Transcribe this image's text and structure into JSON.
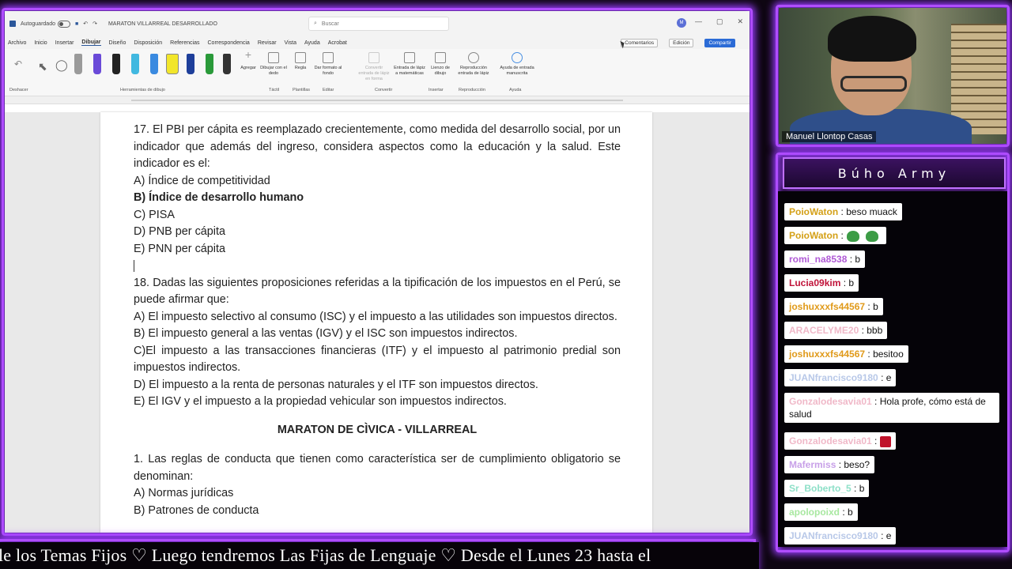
{
  "word": {
    "autosave_label": "Autoguardado",
    "doc_title": "MARATON VILLARREAL DESARROLLADO",
    "search_placeholder": "Buscar",
    "user_initials": "M",
    "menu": [
      "Archivo",
      "Inicio",
      "Insertar",
      "Dibujar",
      "Diseño",
      "Disposición",
      "Referencias",
      "Correspondencia",
      "Revisar",
      "Vista",
      "Ayuda",
      "Acrobat"
    ],
    "active_menu": "Dibujar",
    "comments_label": "Comentarios",
    "edit_label": "Edición",
    "share_label": "Compartir",
    "ribbon": {
      "undo_label": "Deshacer",
      "drawing_tools_label": "Herramientas de dibujo",
      "add_label": "Agregar",
      "draw_finger_label": "Dibujar con el dedo",
      "ruler_label": "Regla",
      "format_bg_label": "Dar formato al fondo",
      "convert_shape_label": "Convertir entrada de lápiz en forma",
      "ink_math_label": "Entrada de lápiz a matemáticas",
      "canvas_label": "Lienzo de dibujo",
      "replay_label": "Reproducción entrada de lápiz",
      "help_ink_label": "Ayuda de entrada manuscrita",
      "groups": [
        "Táctil",
        "Plantillas",
        "Editar",
        "Convertir",
        "Insertar",
        "Reproducción",
        "Ayuda"
      ]
    },
    "document": {
      "q17_text": "17. El PBI per cápita es reemplazado crecientemente, como medida del desarrollo social, por un indicador que además del ingreso, considera aspectos como la educación y la salud. Este indicador es el:",
      "q17_a": "A) Índice de competitividad",
      "q17_b": "B) Índice de desarrollo humano",
      "q17_c": "C) PISA",
      "q17_d": "D) PNB per cápita",
      "q17_e": "E) PNN per cápita",
      "q18_text": "18. Dadas las siguientes proposiciones referidas a la tipificación de los impuestos en el Perú, se puede afirmar que:",
      "q18_a": "A) El impuesto selectivo al consumo (ISC) y el impuesto a las utilidades son impuestos directos.",
      "q18_b": "B) El impuesto general a las ventas (IGV) y el ISC son impuestos indirectos.",
      "q18_c": "C)El impuesto a las transacciones financieras (ITF) y el impuesto al patrimonio predial son impuestos indirectos.",
      "q18_d": "D) El impuesto a la renta de personas naturales y el ITF son impuestos directos.",
      "q18_e": "E) El IGV y el impuesto a la propiedad vehicular son impuestos indirectos.",
      "section_title": "MARATON DE CÌVICA - VILLARREAL",
      "q1_text": "1. Las reglas de conducta que tienen como característica ser de cumplimiento obligatorio se denominan:",
      "q1_a": "A) Normas jurídicas",
      "q1_b": "B) Patrones de conducta"
    }
  },
  "webcam": {
    "name": "Manuel Llontop Casas"
  },
  "chat": {
    "title": "Búho Army",
    "messages": [
      {
        "user": "PoioWaton",
        "text": ": beso muack",
        "color": "#d4a017"
      },
      {
        "user": "PoioWaton",
        "text": ":",
        "color": "#d4a017"
      },
      {
        "user": "romi_na8538",
        "text": ": b",
        "color": "#b05ad6"
      },
      {
        "user": "Lucia09kim",
        "text": ": b",
        "color": "#c0133a"
      },
      {
        "user": "joshuxxxfs44567",
        "text": ": b",
        "color": "#e09a1a"
      },
      {
        "user": "ARACELYME20",
        "text": ": bbb",
        "color": "#f0b8c8"
      },
      {
        "user": "joshuxxxfs44567",
        "text": ": besitoo",
        "color": "#e09a1a"
      },
      {
        "user": "JUANfrancisco9180",
        "text": ": e",
        "color": "#b8c8e8"
      },
      {
        "user": "Gonzalodesavia01",
        "text": ": Hola profe, cómo está de salud",
        "color": "#f0b8c8"
      },
      {
        "user": "Gonzalodesavia01",
        "text": ":",
        "color": "#f0b8c8"
      },
      {
        "user": "Mafermiss",
        "text": ": beso?",
        "color": "#c8a0e8"
      },
      {
        "user": "Sr_Boberto_5",
        "text": ": b",
        "color": "#8ee0c8"
      },
      {
        "user": "apolopoixd",
        "text": ": b",
        "color": "#a8e8a0"
      },
      {
        "user": "JUANfrancisco9180",
        "text": ": e",
        "color": "#b8c8e8"
      }
    ]
  },
  "ticker": {
    "text": "le los Temas Fijos   ♡   Luego tendremos Las Fijas de Lenguaje   ♡   Desde el Lunes 23 hasta el"
  },
  "colors": {
    "neon": "#b04dff",
    "word_accent": "#2b579a"
  }
}
